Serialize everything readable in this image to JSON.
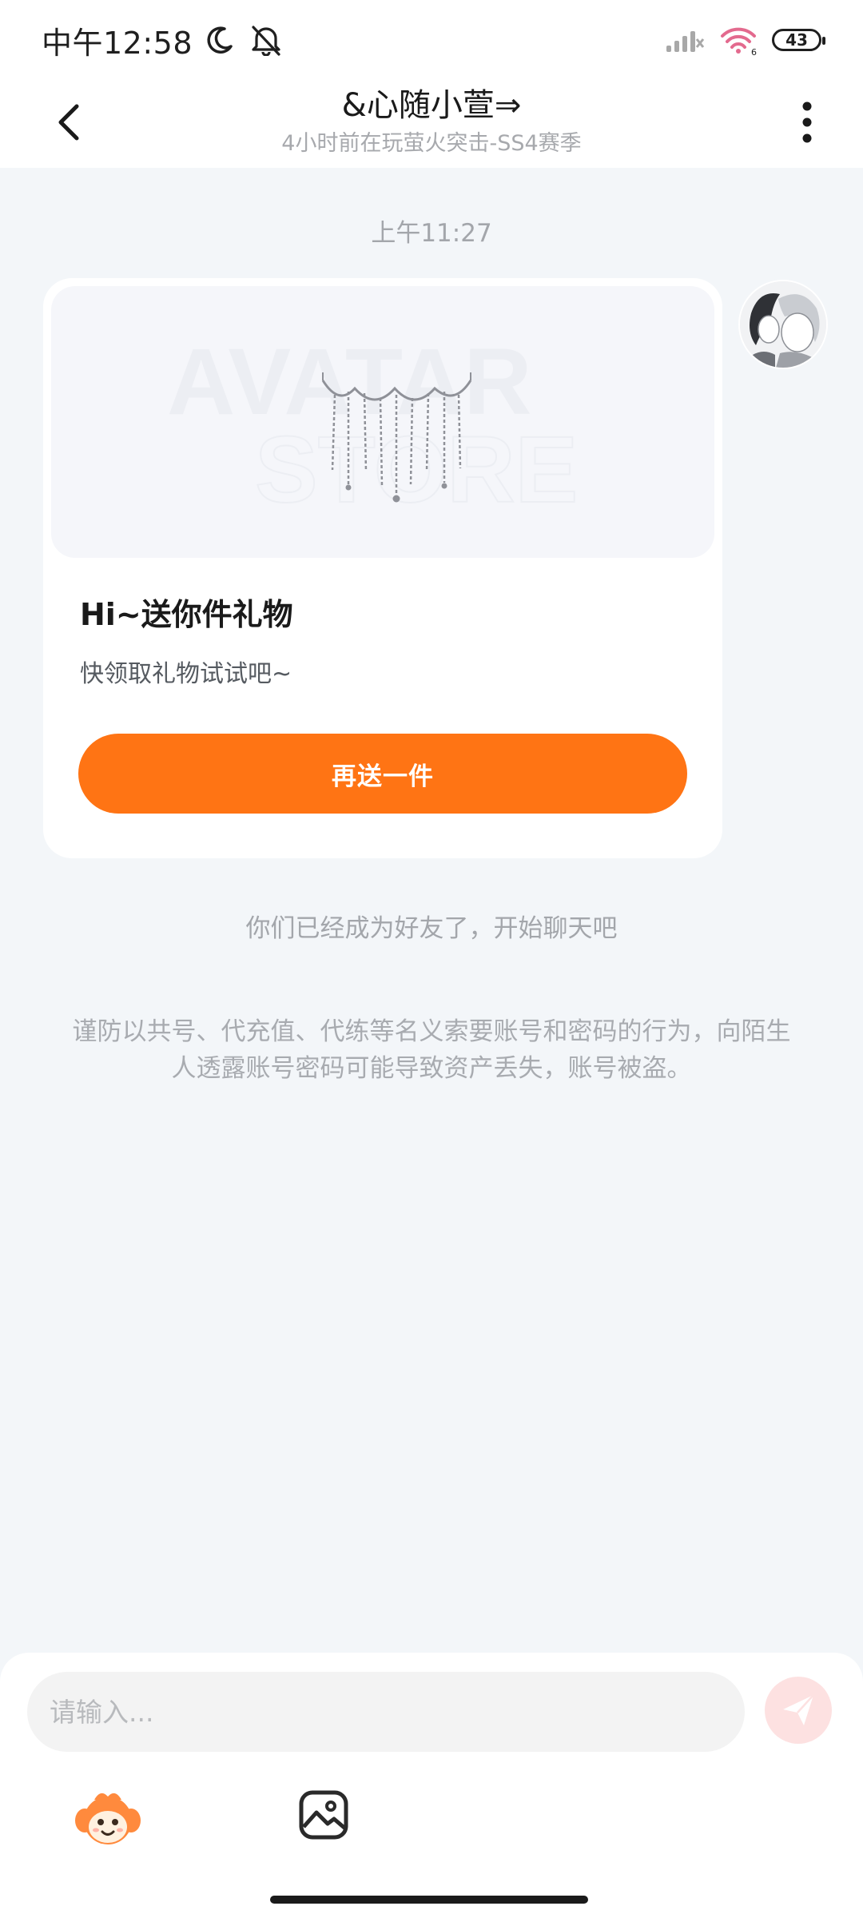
{
  "status_bar": {
    "time": "中午12:58",
    "battery": "43",
    "icons": [
      "moon-icon",
      "bell-off-icon",
      "signal-icon",
      "wifi-icon",
      "battery-icon"
    ]
  },
  "header": {
    "title": "&心随小萱⇒",
    "subtitle": "4小时前在玩萤火突击-SS4赛季",
    "icons": [
      "back-icon",
      "more-icon"
    ]
  },
  "chat": {
    "timestamp": "上午11:27",
    "gift_card": {
      "watermark_line1": "AVATAR",
      "watermark_line2": "STORE",
      "title": "Hi~送你件礼物",
      "description": "快领取礼物试试吧~",
      "button_label": "再送一件"
    },
    "system_message": "你们已经成为好友了，开始聊天吧",
    "warning_message": "谨防以共号、代充值、代练等名义索要账号和密码的行为，向陌生人透露账号密码可能导致资产丢失，账号被盗。"
  },
  "composer": {
    "placeholder": "请输入...",
    "icons": [
      "send-icon",
      "emoji-icon",
      "image-icon"
    ]
  },
  "colors": {
    "accent": "#ff7414",
    "background": "#f3f6f9",
    "send_disabled": "#fde1e1"
  }
}
